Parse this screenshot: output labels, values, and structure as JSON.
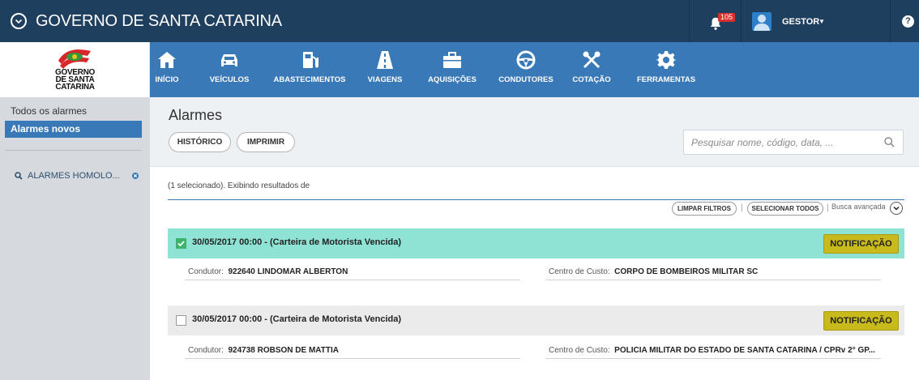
{
  "topbar": {
    "title": "GOVERNO DE SANTA CATARINA",
    "notification_count": "105",
    "user_name": "GESTOR",
    "help_label": "?"
  },
  "logo": {
    "line1": "GOVERNO",
    "line2": "DE SANTA",
    "line3": "CATARINA"
  },
  "nav": {
    "items": [
      {
        "label": "INÍCIO",
        "icon": "home-icon"
      },
      {
        "label": "VEÍCULOS",
        "icon": "car-icon"
      },
      {
        "label": "ABASTECIMENTOS",
        "icon": "fuel-pump-icon"
      },
      {
        "label": "VIAGENS",
        "icon": "road-icon"
      },
      {
        "label": "AQUISIÇÕES",
        "icon": "briefcase-icon"
      },
      {
        "label": "CONDUTORES",
        "icon": "steering-wheel-icon"
      },
      {
        "label": "COTAÇÃO",
        "icon": "tools-icon"
      },
      {
        "label": "FERRAMENTAS",
        "icon": "gear-icon"
      }
    ]
  },
  "sidebar": {
    "items": [
      {
        "label": "Todos os alarmes",
        "active": false
      },
      {
        "label": "Alarmes novos",
        "active": true
      }
    ],
    "saved_filter": "ALARMES HOMOLO..."
  },
  "page": {
    "title": "Alarmes",
    "history_button": "HISTÓRICO",
    "print_button": "IMPRIMIR",
    "search_placeholder": "Pesquisar nome, código, data, ..."
  },
  "results": {
    "info": "(1 selecionado). Exibindo resultados de",
    "clear_filters": "LIMPAR FILTROS",
    "select_all": "SELECIONAR TODOS",
    "advanced_search": "Busca avançada",
    "separator": "|"
  },
  "alarms": [
    {
      "title": "30/05/2017 00:00 - (Carteira de Motorista Vencida)",
      "selected": true,
      "badge": "NOTIFICAÇÃO",
      "driver_label": "Condutor:",
      "driver_value": "922640 LINDOMAR ALBERTON",
      "cost_center_label": "Centro de Custo:",
      "cost_center_value": "CORPO DE BOMBEIROS MILITAR SC"
    },
    {
      "title": "30/05/2017 00:00 - (Carteira de Motorista Vencida)",
      "selected": false,
      "badge": "NOTIFICAÇÃO",
      "driver_label": "Condutor:",
      "driver_value": "924738 ROBSON DE MATTIA",
      "cost_center_label": "Centro de Custo:",
      "cost_center_value": "POLICIA MILITAR DO ESTADO DE SANTA CATARINA / CPRv 2° GP..."
    }
  ],
  "colors": {
    "topbar": "#1f3f5e",
    "nav": "#3a79b8",
    "selected_row": "#8fe3d4",
    "badge": "#c8b91c"
  }
}
